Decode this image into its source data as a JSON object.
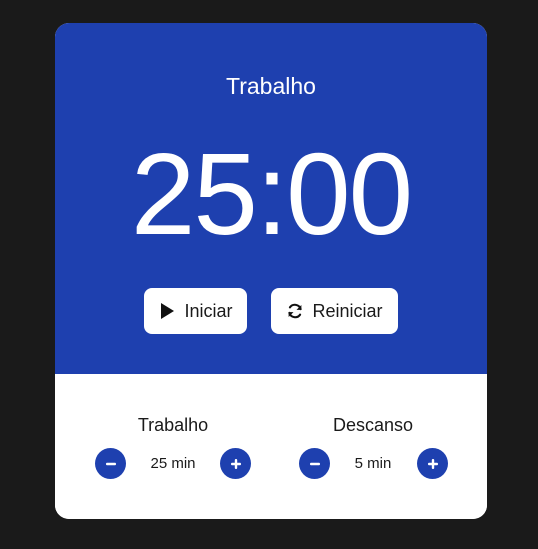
{
  "app": {
    "mode_title": "Trabalho",
    "timer_display": "25:00"
  },
  "controls": {
    "start_label": "Iniciar",
    "reset_label": "Reiniciar"
  },
  "settings": {
    "work": {
      "label": "Trabalho",
      "value": "25 min"
    },
    "break": {
      "label": "Descanso",
      "value": "5 min"
    }
  },
  "icons": {
    "start": "play-icon",
    "reset": "refresh-icon",
    "decrease": "minus-icon",
    "increase": "plus-icon"
  },
  "colors": {
    "primary": "#1e40af",
    "background": "#1a1a1a",
    "surface": "#ffffff",
    "text": "#1a1a1a"
  }
}
